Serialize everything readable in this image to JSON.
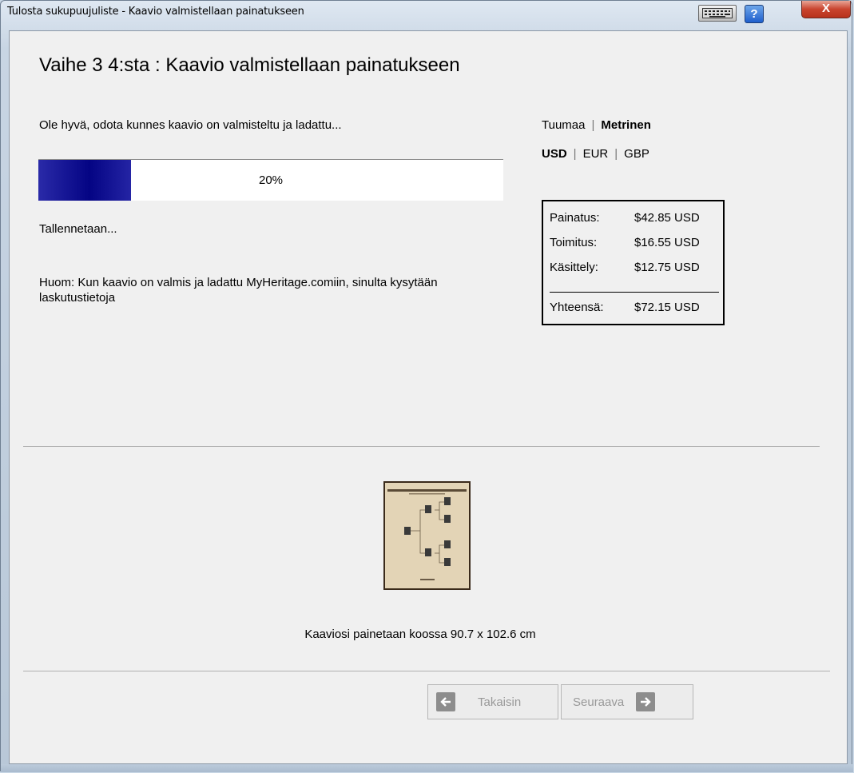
{
  "window": {
    "title": "Tulosta sukupuujuliste - Kaavio valmistellaan painatukseen",
    "close_label": "X",
    "help_label": "?"
  },
  "step": {
    "heading": "Vaihe 3 4:sta : Kaavio valmistellaan painatukseen"
  },
  "progress": {
    "wait_text": "Ole hyvä, odota kunnes kaavio on valmisteltu ja ladattu...",
    "percent_value": 20,
    "percent_label": "20%",
    "status_text": "Tallennetaan...",
    "note_text": "Huom: Kun kaavio on valmis ja ladattu MyHeritage.comiin, sinulta kysytään laskutustietoja"
  },
  "units": {
    "inch": "Tuumaa",
    "metric": "Metrinen",
    "selected": "Metrinen"
  },
  "currency": {
    "usd": "USD",
    "eur": "EUR",
    "gbp": "GBP",
    "selected": "USD"
  },
  "prices": {
    "printing_label": "Painatus:",
    "printing_value": "$42.85 USD",
    "shipping_label": "Toimitus:",
    "shipping_value": "$16.55 USD",
    "handling_label": "Käsittely:",
    "handling_value": "$12.75 USD",
    "total_label": "Yhteensä:",
    "total_value": "$72.15 USD"
  },
  "preview": {
    "size_text": "Kaaviosi painetaan koossa 90.7 x 102.6 cm"
  },
  "nav": {
    "back_label": "Takaisin",
    "next_label": "Seuraava"
  },
  "colors": {
    "progress_fill": "#05058a",
    "thumbnail_bg": "#e3d4b6"
  }
}
